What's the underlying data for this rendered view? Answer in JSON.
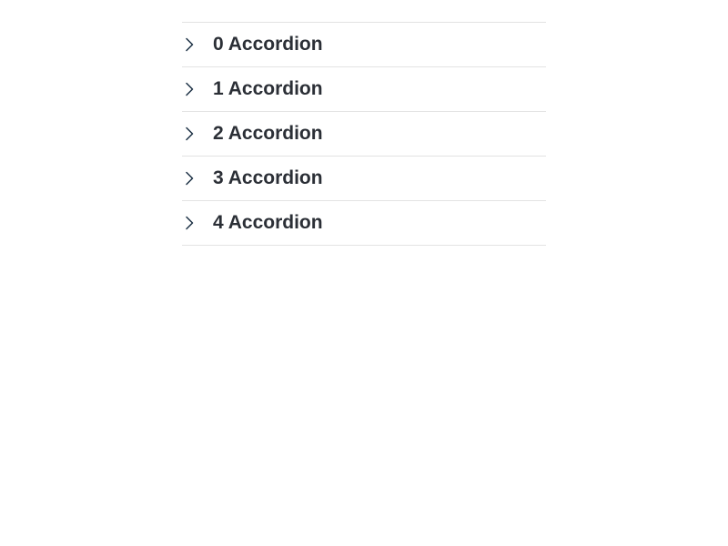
{
  "accordion": {
    "items": [
      {
        "label": "0 Accordion",
        "icon": "chevron-right-icon",
        "expanded": false
      },
      {
        "label": "1 Accordion",
        "icon": "chevron-right-icon",
        "expanded": false
      },
      {
        "label": "2 Accordion",
        "icon": "chevron-right-icon",
        "expanded": false
      },
      {
        "label": "3 Accordion",
        "icon": "chevron-right-icon",
        "expanded": false
      },
      {
        "label": "4 Accordion",
        "icon": "chevron-right-icon",
        "expanded": false
      }
    ]
  },
  "colors": {
    "text": "#2b2f36",
    "divider": "#e3e3e3",
    "icon": "#1f3347"
  }
}
